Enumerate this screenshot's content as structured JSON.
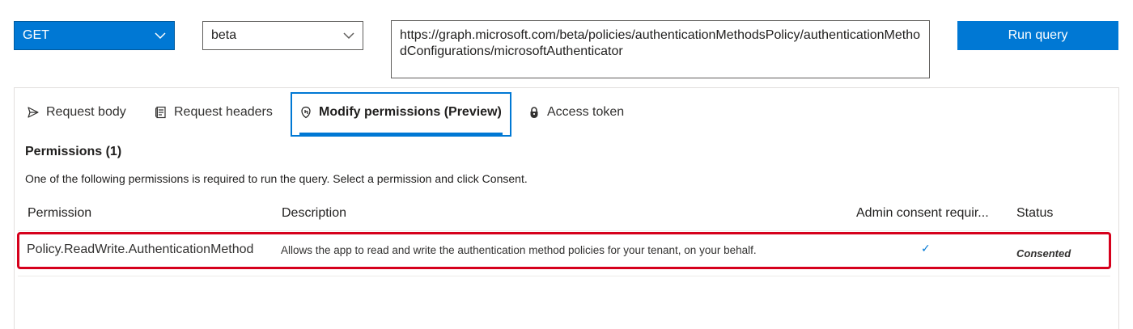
{
  "toolbar": {
    "method": "GET",
    "version": "beta",
    "url": "https://graph.microsoft.com/beta/policies/authenticationMethodsPolicy/authenticationMethodConfigurations/microsoftAuthenticator",
    "run_label": "Run query"
  },
  "tabs": [
    {
      "label": "Request body",
      "icon": "send-icon"
    },
    {
      "label": "Request headers",
      "icon": "document-icon"
    },
    {
      "label": "Modify permissions (Preview)",
      "icon": "shield-hand-icon",
      "active": true
    },
    {
      "label": "Access token",
      "icon": "lock-icon"
    }
  ],
  "permissions": {
    "title": "Permissions (1)",
    "instructions": "One of the following permissions is required to run the query. Select a permission and click Consent.",
    "columns": [
      "Permission",
      "Description",
      "Admin consent requir...",
      "Status"
    ],
    "rows": [
      {
        "permission": "Policy.ReadWrite.AuthenticationMethod",
        "description": "Allows the app to read and write the authentication method policies for your tenant, on your behalf.",
        "admin_consent": "✓",
        "status": "Consented"
      }
    ]
  },
  "colors": {
    "accent": "#0078d4",
    "highlight": "#d6001c"
  }
}
